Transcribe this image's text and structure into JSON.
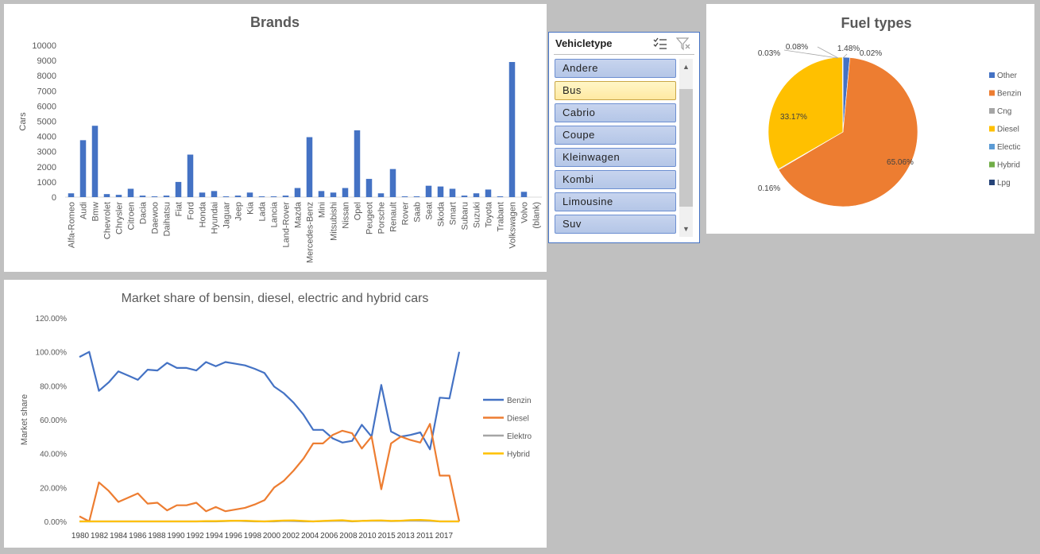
{
  "chart_data": [
    {
      "type": "bar",
      "title": "Brands",
      "ylabel": "Cars",
      "xlabel": "",
      "ylim": [
        0,
        10000
      ],
      "yticks": [
        0,
        1000,
        2000,
        3000,
        4000,
        5000,
        6000,
        7000,
        8000,
        9000,
        10000
      ],
      "color": "#4472c4",
      "categories": [
        "Alfa-Romeo",
        "Audi",
        "Bmw",
        "Chevrolet",
        "Chrysler",
        "Citroen",
        "Dacia",
        "Daewoo",
        "Daihatsu",
        "Fiat",
        "Ford",
        "Honda",
        "Hyundai",
        "Jaguar",
        "Jeep",
        "Kia",
        "Lada",
        "Lancia",
        "Land-Rover",
        "Mazda",
        "Mercedes-Benz",
        "Mini",
        "Mitsubishi",
        "Nissan",
        "Opel",
        "Peugeot",
        "Porsche",
        "Renault",
        "Rover",
        "Saab",
        "Seat",
        "Skoda",
        "Smart",
        "Subaru",
        "Suzuki",
        "Toyota",
        "Trabant",
        "Volkswagen",
        "Volvo",
        "(blank)"
      ],
      "values": [
        250,
        3750,
        4700,
        200,
        150,
        550,
        100,
        50,
        100,
        1000,
        2800,
        300,
        400,
        50,
        100,
        300,
        50,
        50,
        100,
        600,
        3950,
        400,
        300,
        600,
        4400,
        1200,
        250,
        1850,
        50,
        50,
        750,
        700,
        550,
        100,
        250,
        500,
        50,
        8900,
        350,
        0
      ]
    },
    {
      "type": "pie",
      "title": "Fuel types",
      "slices": [
        {
          "name": "Other",
          "value": 1.48,
          "label": "1.48%",
          "color": "#4472c4"
        },
        {
          "name": "Benzin",
          "value": 65.06,
          "label": "65.06%",
          "color": "#ed7d31"
        },
        {
          "name": "Cng",
          "value": 0.16,
          "label": "0.16%",
          "color": "#a5a5a5"
        },
        {
          "name": "Diesel",
          "value": 33.17,
          "label": "33.17%",
          "color": "#ffc000"
        },
        {
          "name": "Electic",
          "value": 0.03,
          "label": "0.03%",
          "color": "#5b9bd5"
        },
        {
          "name": "Hybrid",
          "value": 0.08,
          "label": "0.08%",
          "color": "#70ad47"
        },
        {
          "name": "Lpg",
          "value": 0.02,
          "label": "0.02%",
          "color": "#264478"
        }
      ],
      "legend": [
        "Other",
        "Benzin",
        "Cng",
        "Diesel",
        "Electic",
        "Hybrid",
        "Lpg"
      ],
      "legend_position": "right"
    },
    {
      "type": "line",
      "title": "Market share of bensin, diesel, electric and hybrid cars",
      "ylabel": "Market share",
      "xlabel": "",
      "ylim": [
        0,
        1.2
      ],
      "yticks": [
        "0.00%",
        "20.00%",
        "40.00%",
        "60.00%",
        "80.00%",
        "100.00%",
        "120.00%"
      ],
      "x": [
        "1980",
        "1981",
        "1982",
        "1983",
        "1984",
        "1985",
        "1986",
        "1987",
        "1988",
        "1989",
        "1990",
        "1991",
        "1992",
        "1993",
        "1994",
        "1995",
        "1996",
        "1997",
        "1998",
        "1999",
        "2000",
        "2001",
        "2002",
        "2003",
        "2004",
        "2005",
        "2006",
        "2007",
        "2008",
        "2009",
        "2010",
        "2015",
        "2014",
        "2013",
        "2012",
        "2011",
        "2016",
        "2017"
      ],
      "x_tick_labels": [
        "1980",
        "1982",
        "1984",
        "1986",
        "1988",
        "1990",
        "1992",
        "1994",
        "1996",
        "1998",
        "2000",
        "2002",
        "2004",
        "2006",
        "2008",
        "2010",
        "2015",
        "2013",
        "2011",
        "2017"
      ],
      "series": [
        {
          "name": "Benzin",
          "color": "#4472c4",
          "values": [
            0.97,
            1.0,
            0.77,
            0.82,
            0.885,
            0.86,
            0.835,
            0.895,
            0.89,
            0.935,
            0.905,
            0.905,
            0.89,
            0.94,
            0.915,
            0.94,
            0.93,
            0.92,
            0.9,
            0.875,
            0.795,
            0.755,
            0.7,
            0.63,
            0.54,
            0.54,
            0.49,
            0.465,
            0.475,
            0.57,
            0.5,
            0.805,
            0.53,
            0.5,
            0.51,
            0.525,
            0.425,
            0.73,
            0.725,
            1.0
          ]
        },
        {
          "name": "Diesel",
          "color": "#ed7d31",
          "values": [
            0.03,
            0.0,
            0.23,
            0.18,
            0.115,
            0.14,
            0.165,
            0.105,
            0.11,
            0.065,
            0.095,
            0.095,
            0.11,
            0.06,
            0.085,
            0.06,
            0.07,
            0.08,
            0.1,
            0.125,
            0.2,
            0.24,
            0.3,
            0.37,
            0.46,
            0.46,
            0.51,
            0.535,
            0.52,
            0.43,
            0.5,
            0.19,
            0.46,
            0.5,
            0.48,
            0.465,
            0.575,
            0.27,
            0.27,
            0.0
          ]
        },
        {
          "name": "Elektro",
          "color": "#a5a5a5",
          "values": [
            0,
            0,
            0,
            0,
            0,
            0,
            0,
            0,
            0,
            0,
            0,
            0,
            0,
            0,
            0,
            0.002,
            0.004,
            0.002,
            0,
            0,
            0,
            0.003,
            0.002,
            0,
            0,
            0.002,
            0.003,
            0.004,
            0,
            0.003,
            0.004,
            0.004,
            0.002,
            0.003,
            0.005,
            0.004,
            0.003,
            0,
            0,
            0
          ]
        },
        {
          "name": "Hybrid",
          "color": "#ffc000",
          "values": [
            0,
            0,
            0,
            0,
            0,
            0,
            0,
            0,
            0,
            0,
            0,
            0,
            0,
            0.002,
            0.002,
            0.003,
            0.004,
            0.004,
            0.002,
            0,
            0.003,
            0.005,
            0.006,
            0.003,
            0,
            0.003,
            0.005,
            0.007,
            0.002,
            0.003,
            0.005,
            0.006,
            0.003,
            0.004,
            0.008,
            0.009,
            0.006,
            0,
            0,
            0
          ]
        }
      ],
      "legend_position": "right"
    }
  ],
  "slicer": {
    "title": "Vehicletype",
    "items": [
      "Andere",
      "Bus",
      "Cabrio",
      "Coupe",
      "Kleinwagen",
      "Kombi",
      "Limousine",
      "Suv"
    ],
    "selected": "Bus"
  }
}
